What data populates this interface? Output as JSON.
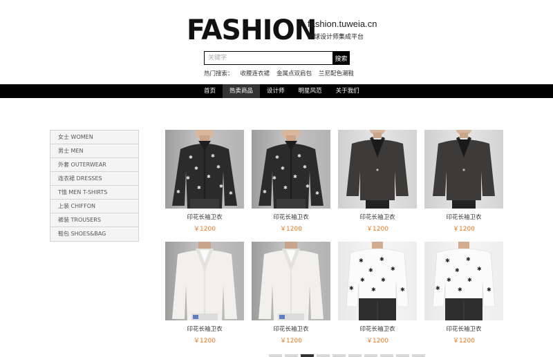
{
  "header": {
    "logo": "FASHION",
    "domain": "fashion.tuweia.cn",
    "slogan": "全球设计师集成平台"
  },
  "search": {
    "placeholder": "关键字",
    "button_label": "搜索"
  },
  "hot_search": {
    "label": "热门搜索：",
    "terms": [
      "收腰连衣裙",
      "金属点双肩包",
      "兰尼配色潮鞋"
    ]
  },
  "nav": {
    "items": [
      {
        "label": "首页",
        "active": false
      },
      {
        "label": "热卖商品",
        "active": true
      },
      {
        "label": "设计师",
        "active": false
      },
      {
        "label": "明星风范",
        "active": false
      },
      {
        "label": "关于我们",
        "active": false
      }
    ]
  },
  "sidebar": {
    "items": [
      {
        "label": "女士 WOMEN"
      },
      {
        "label": "男士 MEN"
      },
      {
        "label": "外套 OUTERWEAR"
      },
      {
        "label": "连衣裙 DRESSES"
      },
      {
        "label": "T恤 MEN T-SHIRTS"
      },
      {
        "label": "上装 CHIFFON"
      },
      {
        "label": "裤装 TROUSERS"
      },
      {
        "label": "鞋包 SHOES&BAG"
      }
    ]
  },
  "products": [
    {
      "name": "印花长袖卫衣",
      "price": "￥1200",
      "image": "black-printed-shirt"
    },
    {
      "name": "印花长袖卫衣",
      "price": "￥1200",
      "image": "black-printed-shirt"
    },
    {
      "name": "印花长袖卫衣",
      "price": "￥1200",
      "image": "black-blazer"
    },
    {
      "name": "印花长袖卫衣",
      "price": "￥1200",
      "image": "black-blazer"
    },
    {
      "name": "印花长袖卫衣",
      "price": "￥1200",
      "image": "white-blazer"
    },
    {
      "name": "印花长袖卫衣",
      "price": "￥1200",
      "image": "white-blazer"
    },
    {
      "name": "印花长袖卫衣",
      "price": "￥1200",
      "image": "white-printed-sweater"
    },
    {
      "name": "印花长袖卫衣",
      "price": "￥1200",
      "image": "white-printed-sweater"
    }
  ],
  "pagination": {
    "pages": 10,
    "current": 3
  },
  "colors": {
    "price": "#e8731a",
    "nav_bg": "#000000",
    "nav_active": "#333333",
    "sidebar_bg": "#f4f4f4"
  }
}
